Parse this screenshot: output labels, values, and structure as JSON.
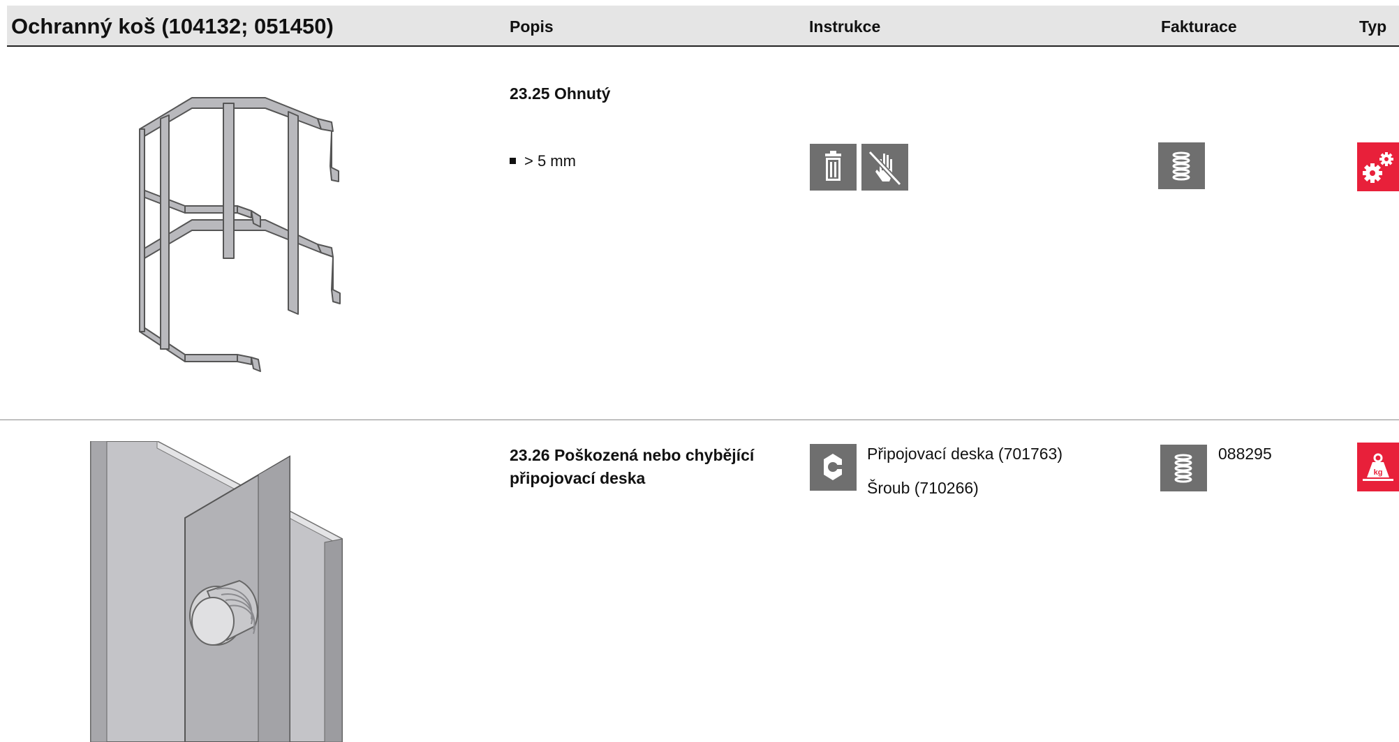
{
  "header": {
    "title": "Ochranný koš (104132; 051450)",
    "col_popis": "Popis",
    "col_instrukce": "Instrukce",
    "col_fakturace": "Fakturace",
    "col_typ": "Typ"
  },
  "rows": [
    {
      "title": "23.25 Ohnutý",
      "bullet": "> 5 mm",
      "instruction_icons": [
        "trash-icon",
        "no-touch-hand-icon"
      ],
      "billing_icon": "coil-icon",
      "type_icon": "gears-icon"
    },
    {
      "title_line1": "23.26 Poškozená nebo chybějící",
      "title_line2": "připojovací deska",
      "instruction_icon": "nut-icon",
      "parts": [
        "Připojovací deska (701763)",
        "Šroub (710266)"
      ],
      "billing_icon": "coil-icon",
      "billing_code": "088295",
      "type_icon": "weight-kg-icon"
    }
  ],
  "colors": {
    "icon_gray": "#6f6f6f",
    "accent_red": "#e8203a",
    "header_bg": "#e5e5e5"
  }
}
